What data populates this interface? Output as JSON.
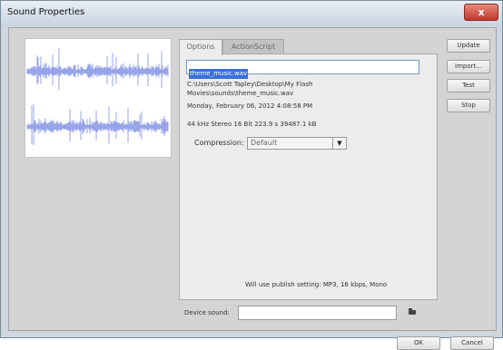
{
  "window": {
    "title": "Sound Properties",
    "close_glyph": "x"
  },
  "tabs": [
    {
      "label": "Options",
      "active": true
    },
    {
      "label": "ActionScript",
      "active": false
    }
  ],
  "options": {
    "file_name": "theme_music.wav",
    "path": "C:\\Users\\Scott Tapley\\Desktop\\My Flash Movies\\sounds\\theme_music.wav",
    "date": "Monday, February 06, 2012  4:08:58 PM",
    "format_info": "44 kHz Stereo 16 Bit 223.9 s 39487.1 kB",
    "compression_label": "Compression:",
    "compression_value": "Default",
    "publish_note": "Will use publish setting: MP3, 16 kbps, Mono"
  },
  "device_sound": {
    "label": "Device sound:",
    "value": ""
  },
  "buttons": {
    "update": "Update",
    "import": "Import...",
    "test": "Test",
    "stop": "Stop",
    "ok": "OK",
    "cancel": "Cancel"
  },
  "icons": {
    "folder": "folder-icon",
    "dropdown": "chevron-down-icon",
    "close": "close-icon"
  },
  "colors": {
    "waveform": "#6b7ee0",
    "selection": "#3a6fd8",
    "close_button": "#c0392b"
  }
}
